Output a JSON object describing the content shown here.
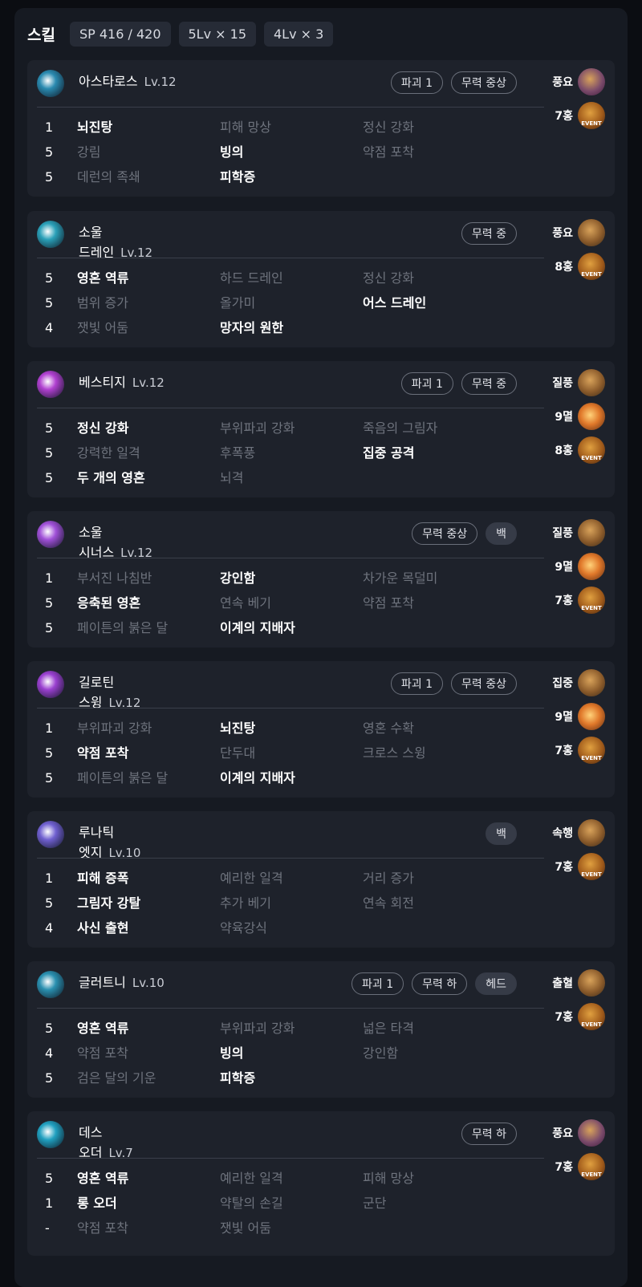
{
  "header": {
    "title": "스킬",
    "chips": [
      "SP 416 / 420",
      "5Lv × 15",
      "4Lv × 3"
    ]
  },
  "skills": [
    {
      "name": "아스타로스",
      "name2": "",
      "level": "Lv.12",
      "tags": [
        {
          "label": "파괴 1",
          "filled": false
        },
        {
          "label": "무력 중상",
          "filled": false
        }
      ],
      "icon_color": "#2a8ab0",
      "tripods": [
        {
          "level": "1",
          "options": [
            {
              "label": "뇌진탕",
              "active": true
            },
            {
              "label": "피해 망상",
              "active": false
            },
            {
              "label": "정신 강화",
              "active": false
            }
          ]
        },
        {
          "level": "5",
          "options": [
            {
              "label": "강림",
              "active": false
            },
            {
              "label": "빙의",
              "active": true
            },
            {
              "label": "약점 포착",
              "active": false
            }
          ]
        },
        {
          "level": "5",
          "options": [
            {
              "label": "데런의 족쇄",
              "active": false
            },
            {
              "label": "피학증",
              "active": true
            },
            {
              "label": "",
              "active": false
            }
          ]
        }
      ],
      "gems": [
        {
          "label": "풍요",
          "icon": "rune-purple"
        },
        {
          "label": "7홍",
          "icon": "event"
        }
      ]
    },
    {
      "name": "소울",
      "name2": "드레인",
      "level": "Lv.12",
      "tags": [
        {
          "label": "무력 중",
          "filled": false
        }
      ],
      "icon_color": "#2aa0b8",
      "tripods": [
        {
          "level": "5",
          "options": [
            {
              "label": "영혼 역류",
              "active": true
            },
            {
              "label": "하드 드레인",
              "active": false
            },
            {
              "label": "정신 강화",
              "active": false
            }
          ]
        },
        {
          "level": "5",
          "options": [
            {
              "label": "범위 증가",
              "active": false
            },
            {
              "label": "올가미",
              "active": false
            },
            {
              "label": "어스 드레인",
              "active": true
            }
          ]
        },
        {
          "level": "4",
          "options": [
            {
              "label": "잿빛 어둠",
              "active": false
            },
            {
              "label": "망자의 원한",
              "active": true
            },
            {
              "label": "",
              "active": false
            }
          ]
        }
      ],
      "gems": [
        {
          "label": "풍요",
          "icon": "rune"
        },
        {
          "label": "8홍",
          "icon": "event"
        }
      ]
    },
    {
      "name": "베스티지",
      "name2": "",
      "level": "Lv.12",
      "tags": [
        {
          "label": "파괴 1",
          "filled": false
        },
        {
          "label": "무력 중",
          "filled": false
        }
      ],
      "icon_color": "#b040d0",
      "tripods": [
        {
          "level": "5",
          "options": [
            {
              "label": "정신 강화",
              "active": true
            },
            {
              "label": "부위파괴 강화",
              "active": false
            },
            {
              "label": "죽음의 그림자",
              "active": false
            }
          ]
        },
        {
          "level": "5",
          "options": [
            {
              "label": "강력한 일격",
              "active": false
            },
            {
              "label": "후폭풍",
              "active": false
            },
            {
              "label": "집중 공격",
              "active": true
            }
          ]
        },
        {
          "level": "5",
          "options": [
            {
              "label": "두 개의 영혼",
              "active": true
            },
            {
              "label": "뇌격",
              "active": false
            },
            {
              "label": "",
              "active": false
            }
          ]
        }
      ],
      "gems": [
        {
          "label": "질풍",
          "icon": "rune"
        },
        {
          "label": "9멸",
          "icon": "jewel"
        },
        {
          "label": "8홍",
          "icon": "event"
        }
      ]
    },
    {
      "name": "소울",
      "name2": "시너스",
      "level": "Lv.12",
      "tags": [
        {
          "label": "무력 중상",
          "filled": false
        },
        {
          "label": "백",
          "filled": true
        }
      ],
      "icon_color": "#a050d8",
      "tripods": [
        {
          "level": "1",
          "options": [
            {
              "label": "부서진 나침반",
              "active": false
            },
            {
              "label": "강인함",
              "active": true
            },
            {
              "label": "차가운 목덜미",
              "active": false
            }
          ]
        },
        {
          "level": "5",
          "options": [
            {
              "label": "응축된 영혼",
              "active": true
            },
            {
              "label": "연속 베기",
              "active": false
            },
            {
              "label": "약점 포착",
              "active": false
            }
          ]
        },
        {
          "level": "5",
          "options": [
            {
              "label": "페이튼의 붉은 달",
              "active": false
            },
            {
              "label": "이계의 지배자",
              "active": true
            },
            {
              "label": "",
              "active": false
            }
          ]
        }
      ],
      "gems": [
        {
          "label": "질풍",
          "icon": "rune"
        },
        {
          "label": "9멸",
          "icon": "jewel"
        },
        {
          "label": "7홍",
          "icon": "event"
        }
      ]
    },
    {
      "name": "길로틴",
      "name2": "스윙",
      "level": "Lv.12",
      "tags": [
        {
          "label": "파괴 1",
          "filled": false
        },
        {
          "label": "무력 중상",
          "filled": false
        }
      ],
      "icon_color": "#9a40d0",
      "tripods": [
        {
          "level": "1",
          "options": [
            {
              "label": "부위파괴 강화",
              "active": false
            },
            {
              "label": "뇌진탕",
              "active": true
            },
            {
              "label": "영혼 수확",
              "active": false
            }
          ]
        },
        {
          "level": "5",
          "options": [
            {
              "label": "약점 포착",
              "active": true
            },
            {
              "label": "단두대",
              "active": false
            },
            {
              "label": "크로스 스윙",
              "active": false
            }
          ]
        },
        {
          "level": "5",
          "options": [
            {
              "label": "페이튼의 붉은 달",
              "active": false
            },
            {
              "label": "이계의 지배자",
              "active": true
            },
            {
              "label": "",
              "active": false
            }
          ]
        }
      ],
      "gems": [
        {
          "label": "집중",
          "icon": "rune"
        },
        {
          "label": "9멸",
          "icon": "jewel"
        },
        {
          "label": "7홍",
          "icon": "event"
        }
      ]
    },
    {
      "name": "루나틱",
      "name2": "엣지",
      "level": "Lv.10",
      "tags": [
        {
          "label": "백",
          "filled": true
        }
      ],
      "icon_color": "#7060d0",
      "tripods": [
        {
          "level": "1",
          "options": [
            {
              "label": "피해 증폭",
              "active": true
            },
            {
              "label": "예리한 일격",
              "active": false
            },
            {
              "label": "거리 증가",
              "active": false
            }
          ]
        },
        {
          "level": "5",
          "options": [
            {
              "label": "그림자 강탈",
              "active": true
            },
            {
              "label": "추가 베기",
              "active": false
            },
            {
              "label": "연속 회전",
              "active": false
            }
          ]
        },
        {
          "level": "4",
          "options": [
            {
              "label": "사신 출현",
              "active": true
            },
            {
              "label": "약육강식",
              "active": false
            },
            {
              "label": "",
              "active": false
            }
          ]
        }
      ],
      "gems": [
        {
          "label": "속행",
          "icon": "rune"
        },
        {
          "label": "7홍",
          "icon": "event"
        }
      ]
    },
    {
      "name": "글러트니",
      "name2": "",
      "level": "Lv.10",
      "tags": [
        {
          "label": "파괴 1",
          "filled": false
        },
        {
          "label": "무력 하",
          "filled": false
        },
        {
          "label": "헤드",
          "filled": true
        }
      ],
      "icon_color": "#2a90b0",
      "tripods": [
        {
          "level": "5",
          "options": [
            {
              "label": "영혼 역류",
              "active": true
            },
            {
              "label": "부위파괴 강화",
              "active": false
            },
            {
              "label": "넓은 타격",
              "active": false
            }
          ]
        },
        {
          "level": "4",
          "options": [
            {
              "label": "약점 포착",
              "active": false
            },
            {
              "label": "빙의",
              "active": true
            },
            {
              "label": "강인함",
              "active": false
            }
          ]
        },
        {
          "level": "5",
          "options": [
            {
              "label": "검은 달의 기운",
              "active": false
            },
            {
              "label": "피학증",
              "active": true
            },
            {
              "label": "",
              "active": false
            }
          ]
        }
      ],
      "gems": [
        {
          "label": "출혈",
          "icon": "rune"
        },
        {
          "label": "7홍",
          "icon": "event"
        }
      ]
    },
    {
      "name": "데스",
      "name2": "오더",
      "level": "Lv.7",
      "tags": [
        {
          "label": "무력 하",
          "filled": false
        }
      ],
      "icon_color": "#20a0c0",
      "tripods": [
        {
          "level": "5",
          "options": [
            {
              "label": "영혼 역류",
              "active": true
            },
            {
              "label": "예리한 일격",
              "active": false
            },
            {
              "label": "피해 망상",
              "active": false
            }
          ]
        },
        {
          "level": "1",
          "options": [
            {
              "label": "롱 오더",
              "active": true
            },
            {
              "label": "약탈의 손길",
              "active": false
            },
            {
              "label": "군단",
              "active": false
            }
          ]
        },
        {
          "level": "-",
          "options": [
            {
              "label": "약점 포착",
              "active": false
            },
            {
              "label": "잿빛 어둠",
              "active": false
            },
            {
              "label": "",
              "active": false
            }
          ]
        }
      ],
      "gems": [
        {
          "label": "풍요",
          "icon": "rune-purple"
        },
        {
          "label": "7홍",
          "icon": "event"
        }
      ]
    }
  ]
}
